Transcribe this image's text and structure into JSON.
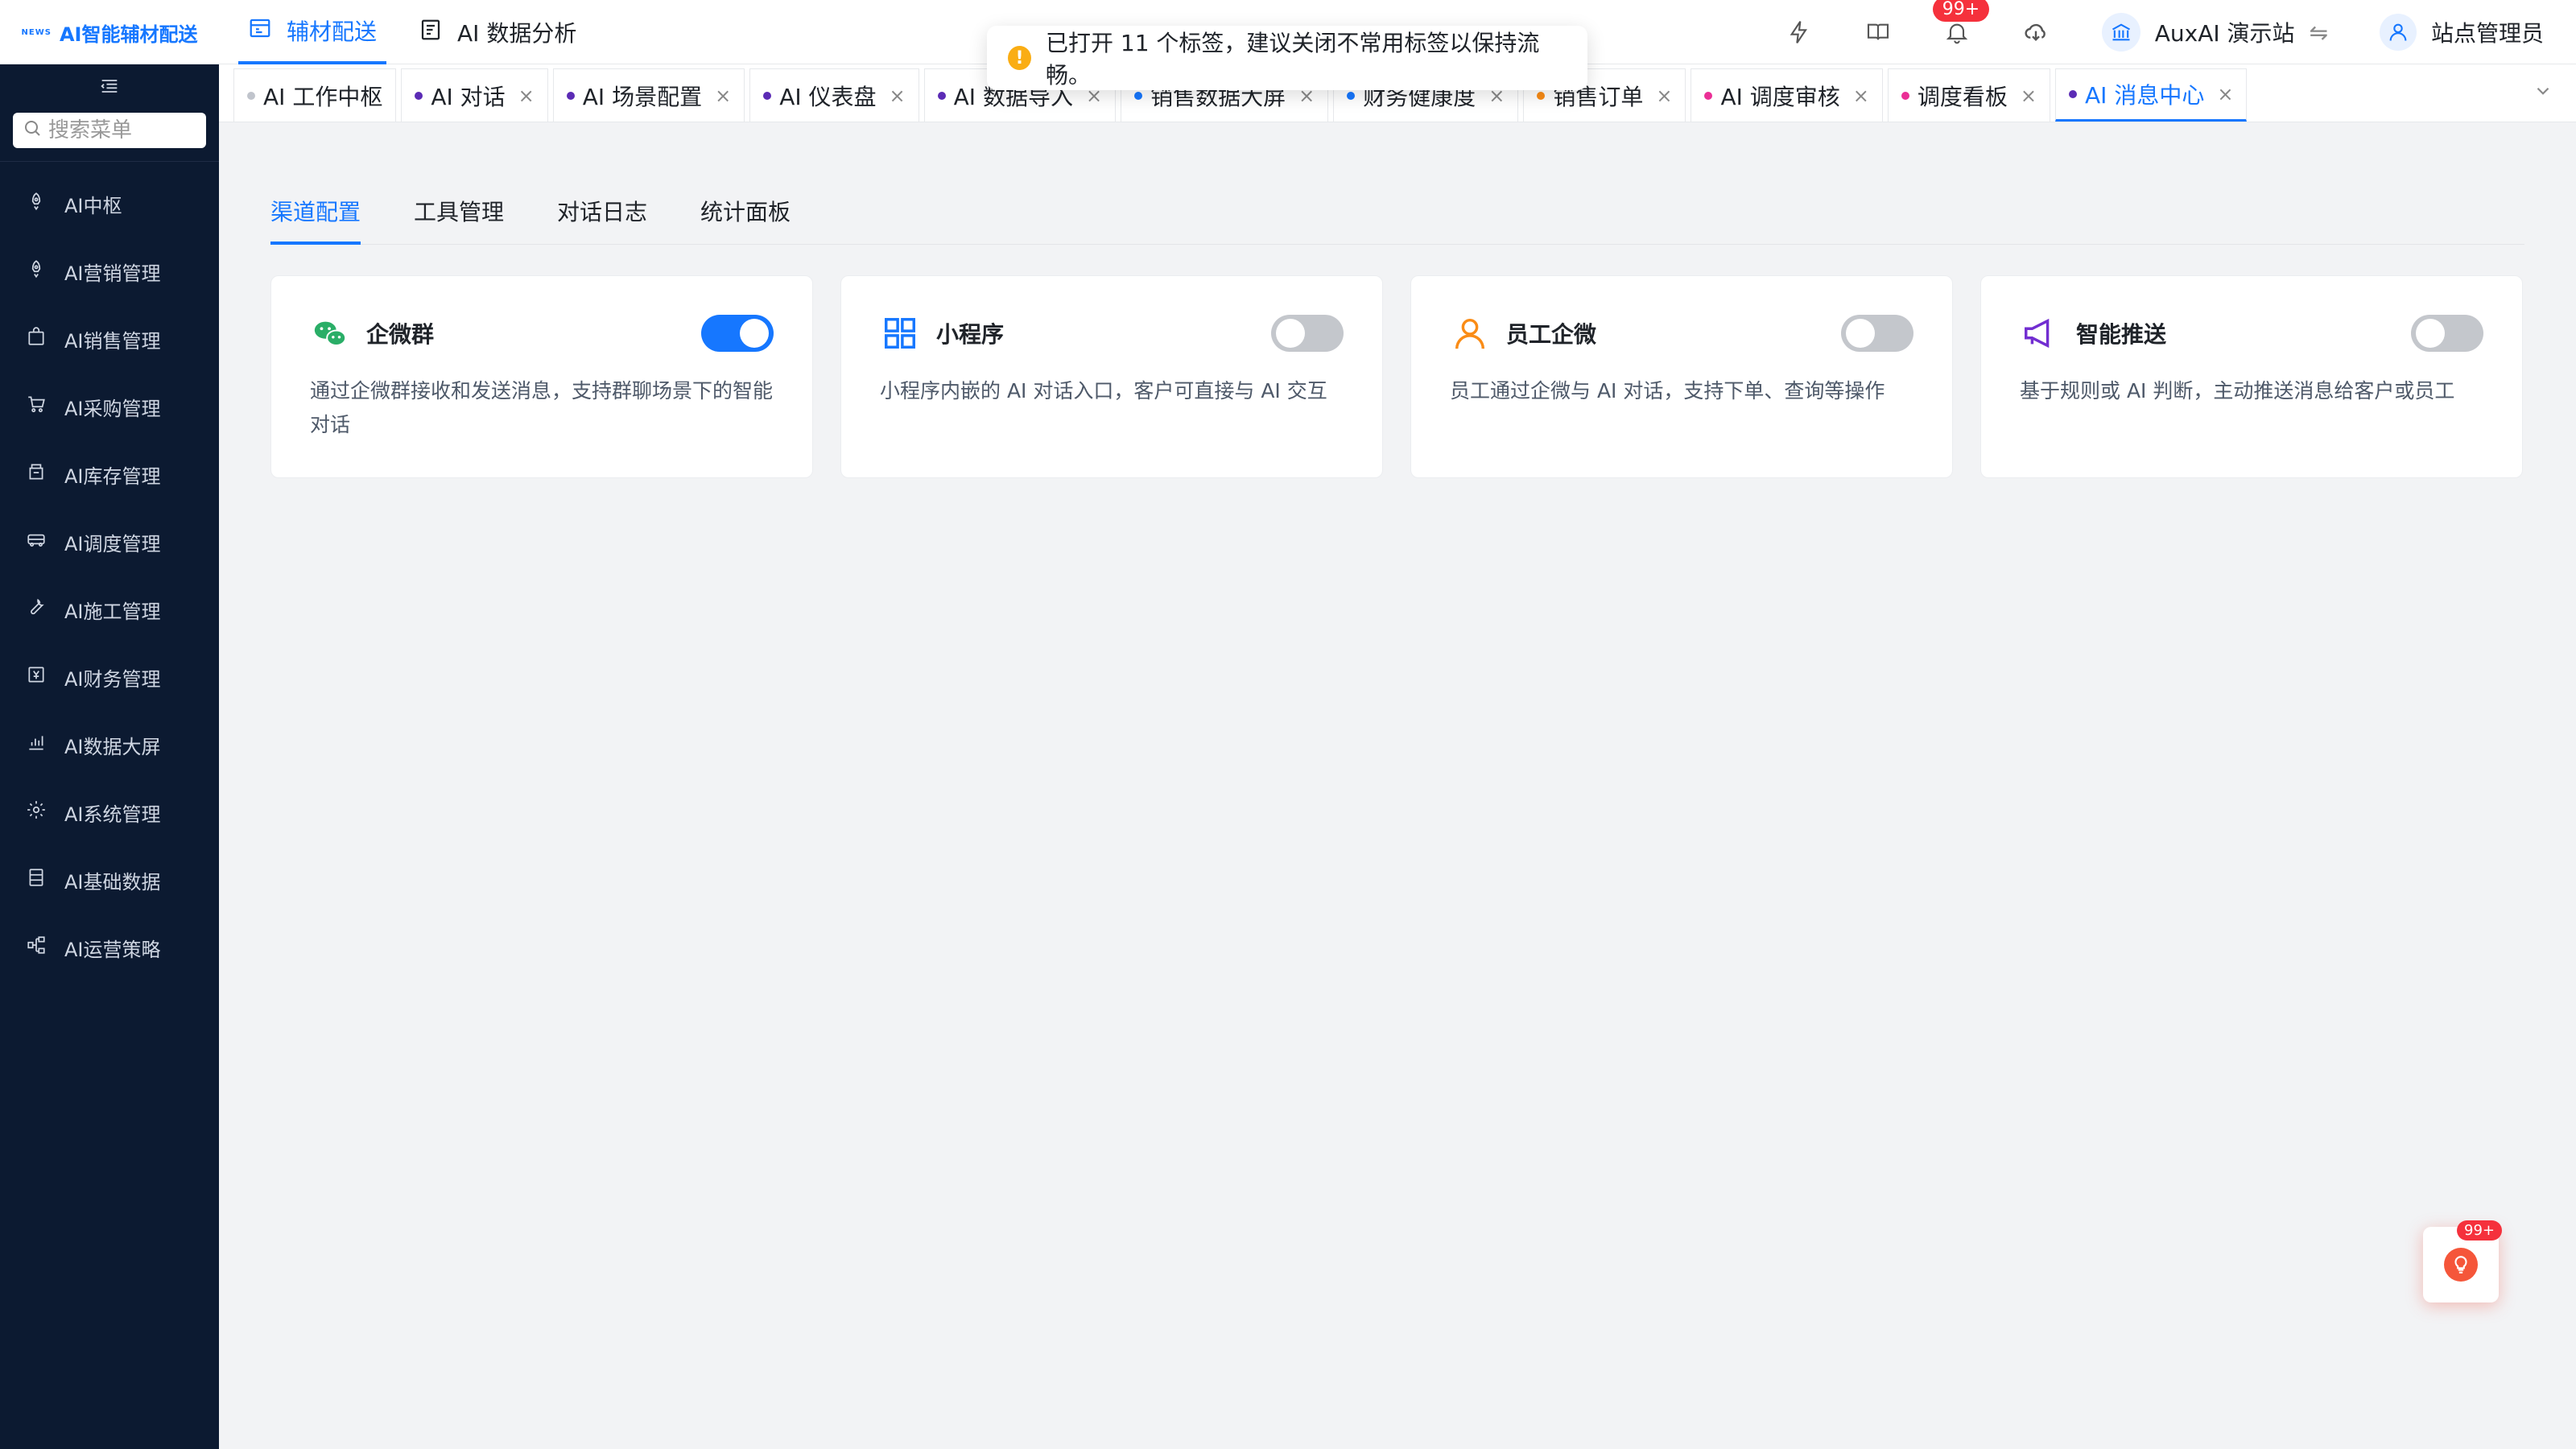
{
  "app": {
    "logo_mark": "NEWS",
    "title": "AI智能辅材配送"
  },
  "topnav": [
    {
      "label": "辅材配送",
      "icon": "store-icon",
      "active": true
    },
    {
      "label": "AI 数据分析",
      "icon": "report-icon",
      "active": false
    }
  ],
  "toolbar": {
    "notification_badge": "99+",
    "site_name": "AuxAI 演示站",
    "swap_symbol": "⇋",
    "user_name": "站点管理员"
  },
  "toast": {
    "message": "已打开 11 个标签，建议关闭不常用标签以保持流畅。",
    "icon": "!"
  },
  "sidebar": {
    "search_placeholder": "搜索菜单",
    "items": [
      {
        "label": "AI中枢",
        "icon": "rocket-icon"
      },
      {
        "label": "AI营销管理",
        "icon": "rocket-icon"
      },
      {
        "label": "AI销售管理",
        "icon": "bag-icon"
      },
      {
        "label": "AI采购管理",
        "icon": "cart-icon"
      },
      {
        "label": "AI库存管理",
        "icon": "inventory-icon"
      },
      {
        "label": "AI调度管理",
        "icon": "truck-icon"
      },
      {
        "label": "AI施工管理",
        "icon": "wrench-icon"
      },
      {
        "label": "AI财务管理",
        "icon": "finance-icon"
      },
      {
        "label": "AI数据大屏",
        "icon": "bar-chart-icon"
      },
      {
        "label": "AI系统管理",
        "icon": "gear-icon"
      },
      {
        "label": "AI基础数据",
        "icon": "database-icon"
      },
      {
        "label": "AI运营策略",
        "icon": "strategy-icon"
      }
    ]
  },
  "tabs": [
    {
      "label": "AI 工作中枢",
      "dot": "#c0c4cc",
      "closable": false,
      "active": false
    },
    {
      "label": "AI 对话",
      "dot": "#5b2bb5",
      "closable": true,
      "active": false
    },
    {
      "label": "AI 场景配置",
      "dot": "#5b2bb5",
      "closable": true,
      "active": false
    },
    {
      "label": "AI 仪表盘",
      "dot": "#5b2bb5",
      "closable": true,
      "active": false
    },
    {
      "label": "AI 数据导入",
      "dot": "#5b2bb5",
      "closable": true,
      "active": false
    },
    {
      "label": "销售数据大屏",
      "dot": "#1677ff",
      "closable": true,
      "active": false
    },
    {
      "label": "财务健康度",
      "dot": "#1677ff",
      "closable": true,
      "active": false
    },
    {
      "label": "销售订单",
      "dot": "#fa8c16",
      "closable": true,
      "active": false
    },
    {
      "label": "AI 调度审核",
      "dot": "#eb2f96",
      "closable": true,
      "active": false
    },
    {
      "label": "调度看板",
      "dot": "#eb2f96",
      "closable": true,
      "active": false
    },
    {
      "label": "AI 消息中心",
      "dot": "#5b2bb5",
      "closable": true,
      "active": true
    }
  ],
  "tab_close_symbol": "×",
  "subtabs": [
    {
      "label": "渠道配置",
      "active": true
    },
    {
      "label": "工具管理",
      "active": false
    },
    {
      "label": "对话日志",
      "active": false
    },
    {
      "label": "统计面板",
      "active": false
    }
  ],
  "channels": [
    {
      "title": "企微群",
      "icon": "wechat-icon",
      "enabled": true,
      "color": "#2aae67",
      "description": "通过企微群接收和发送消息，支持群聊场景下的智能对话"
    },
    {
      "title": "小程序",
      "icon": "grid-icon",
      "enabled": false,
      "color": "#1677ff",
      "description": "小程序内嵌的 AI 对话入口，客户可直接与 AI 交互"
    },
    {
      "title": "员工企微",
      "icon": "user-icon",
      "enabled": false,
      "color": "#fa8c16",
      "description": "员工通过企微与 AI 对话，支持下单、查询等操作"
    },
    {
      "title": "智能推送",
      "icon": "megaphone-icon",
      "enabled": false,
      "color": "#722ed1",
      "description": "基于规则或 AI 判断，主动推送消息给客户或员工"
    }
  ],
  "float_help": {
    "badge": "99+",
    "icon": "bulb-icon"
  }
}
